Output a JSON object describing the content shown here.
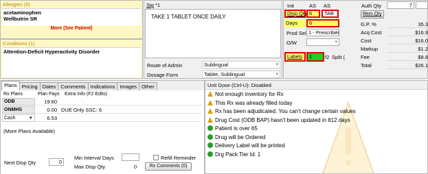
{
  "allergies": {
    "header": "Allergies (5)",
    "items": [
      "acetaminophen",
      "Wellbutrin SR"
    ],
    "more": "More (See Patient)"
  },
  "conditions": {
    "header": "Conditions (1)",
    "items": [
      "Attention-Deficit Hyperactivity Disorder"
    ]
  },
  "sig": {
    "label": "Sig",
    "value": "*1",
    "text": "TAKE 1 TABLET ONCE DAILY"
  },
  "route": {
    "label": "Route of Admin",
    "value": "Sublingual"
  },
  "dosage": {
    "label": "Dosage Form",
    "value": "Tablet, Sublingual"
  },
  "init": {
    "label": "Init",
    "v1": "AS",
    "v2": "AS"
  },
  "disp_qty": {
    "label": "Disp Qty",
    "value": "6",
    "unit": "TAB"
  },
  "days": {
    "label": "Days",
    "value": "6"
  },
  "prod_sel": {
    "label": "Prod Sel",
    "value": "1 - Prescriber"
  },
  "ow": {
    "label": "O/W"
  },
  "labels": {
    "label": "Labels",
    "value": "1",
    "f2": "f2",
    "split": "Split ("
  },
  "auth_qty": {
    "label": "Auth Qty",
    "value": "7"
  },
  "rem_qty": {
    "label": "Rem Qty"
  },
  "pricing": [
    {
      "label": "G.P. %",
      "value": "35.3"
    },
    {
      "label": "Acq Cost",
      "value": "$16.9"
    },
    {
      "label": "Cost",
      "value": "$16.0"
    },
    {
      "label": "Markup",
      "value": "$1.2"
    },
    {
      "label": "Fee",
      "value": "$8.8"
    },
    {
      "label": "Total",
      "value": "$26.1"
    }
  ],
  "tabs": [
    "Plans",
    "Pricing",
    "Dates",
    "Comments",
    "Indications",
    "Images",
    "Other"
  ],
  "plans": {
    "headers": {
      "rx_plans": "Rx Plans",
      "plan_pays": "Plan Pays",
      "extra": "Extra Info (F2 Edits)"
    },
    "rows": [
      {
        "plan": "ODB",
        "pays": "19.60",
        "extra": ""
      },
      {
        "plan": "ONMHS",
        "pays": "0.00",
        "extra": "DUE Only SSC: 6"
      },
      {
        "plan": "Cash",
        "pays": "6.53",
        "extra": ""
      }
    ],
    "more": "(More Plans Available)"
  },
  "next_disp": {
    "label": "Next Disp Qty",
    "value": "0"
  },
  "min_interval": {
    "label": "Min Interval Days",
    "value": ""
  },
  "max_disp": {
    "label": "Max Disp Qty",
    "value": "0"
  },
  "refill_reminder": {
    "label": "Refill Reminder"
  },
  "rx_comments": {
    "label": "Rx Comments (0)"
  },
  "unit_dose": {
    "label": "Unit Dose (Ctrl-U): Disabled"
  },
  "messages": [
    {
      "type": "warning",
      "text": "Not enough inventory for Rx"
    },
    {
      "type": "warning",
      "text": "This Rx was already filled today"
    },
    {
      "type": "warning",
      "text": "Rx has been adjudicated. You can't change certain values"
    },
    {
      "type": "warning",
      "text": "Drug Cost (ODB BAP) hasn't been updated in 812 days"
    },
    {
      "type": "ok",
      "text": "Patient is over 65"
    },
    {
      "type": "ok",
      "text": "Drug will be Ordered"
    },
    {
      "type": "ok",
      "text": "Delivery Label will be printed"
    },
    {
      "type": "ok",
      "text": "Drg Pack Tier Id: 1"
    }
  ],
  "colors": {
    "highlight": "#ffff66",
    "red_border": "#e00000",
    "green": "#22cc22",
    "warn": "#e0a000",
    "ok": "#2a9d2a"
  }
}
